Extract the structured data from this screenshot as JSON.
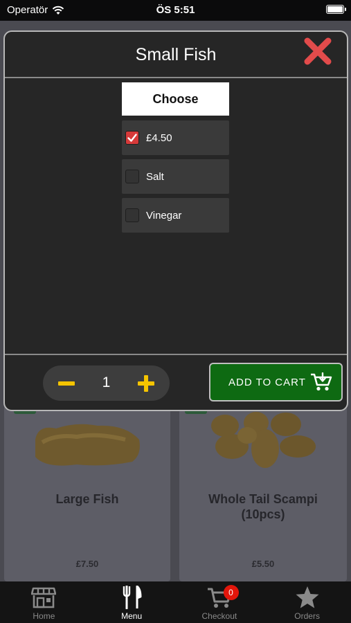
{
  "status_bar": {
    "carrier": "Operatör",
    "time": "ÖS 5:51"
  },
  "menu_background": {
    "items": [
      {
        "name": "Large Fish",
        "price": "£7.50"
      },
      {
        "name": "Whole Tail Scampi (10pcs)",
        "price": "£5.50"
      }
    ]
  },
  "modal": {
    "title": "Small Fish",
    "choose_label": "Choose",
    "options": [
      {
        "label": "£4.50",
        "checked": true
      },
      {
        "label": "Salt",
        "checked": false
      },
      {
        "label": "Vinegar",
        "checked": false
      }
    ],
    "quantity": "1",
    "add_to_cart_label": "ADD TO CART"
  },
  "tab_bar": {
    "tabs": [
      {
        "label": "Home",
        "icon": "store-icon",
        "active": false
      },
      {
        "label": "Menu",
        "icon": "fork-knife-icon",
        "active": true
      },
      {
        "label": "Checkout",
        "icon": "cart-icon",
        "active": false
      },
      {
        "label": "Orders",
        "icon": "star-icon",
        "active": false
      }
    ],
    "cart_badge": "0"
  },
  "colors": {
    "accent_red": "#d63a3a",
    "cart_button_green": "#0e6a12",
    "quantity_yellow": "#f5c400",
    "badge_red": "#e3160b"
  }
}
